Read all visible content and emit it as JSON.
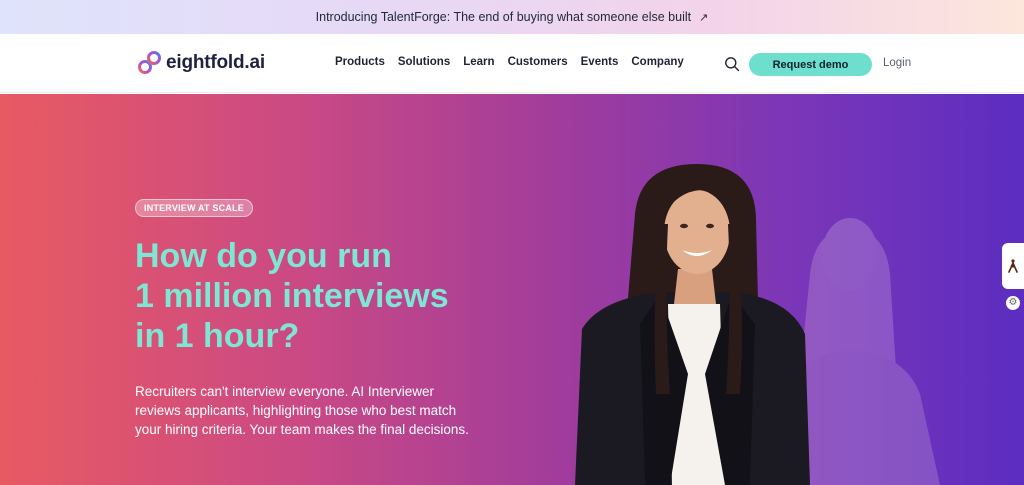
{
  "announcement": {
    "text": "Introducing TalentForge: The end of buying what someone else built",
    "arrow_icon": "arrow-up-right-icon"
  },
  "nav": {
    "logo_text": "eightfold.ai",
    "items": [
      "Products",
      "Solutions",
      "Learn",
      "Customers",
      "Events",
      "Company"
    ],
    "search_icon": "search-icon",
    "demo_label": "Request demo",
    "login_label": "Login"
  },
  "hero": {
    "badge": "INTERVIEW AT SCALE",
    "headline_lines": [
      "How do you run",
      "1 million interviews",
      "in 1 hour?"
    ],
    "body": "Recruiters can't interview everyone. AI Interviewer reviews applicants, highlighting those who best match your hiring criteria. Your team makes the final decisions.",
    "headline_color": "#7ee6d3"
  },
  "colors": {
    "accent_button": "#6ddfcc",
    "hero_gradient": [
      "#e85a62",
      "#cc4a83",
      "#a03c9c",
      "#7a36b8",
      "#5c2dc0"
    ]
  },
  "widgets": {
    "accessibility_icon": "accessibility-person-icon",
    "settings_icon": "gear-icon"
  }
}
